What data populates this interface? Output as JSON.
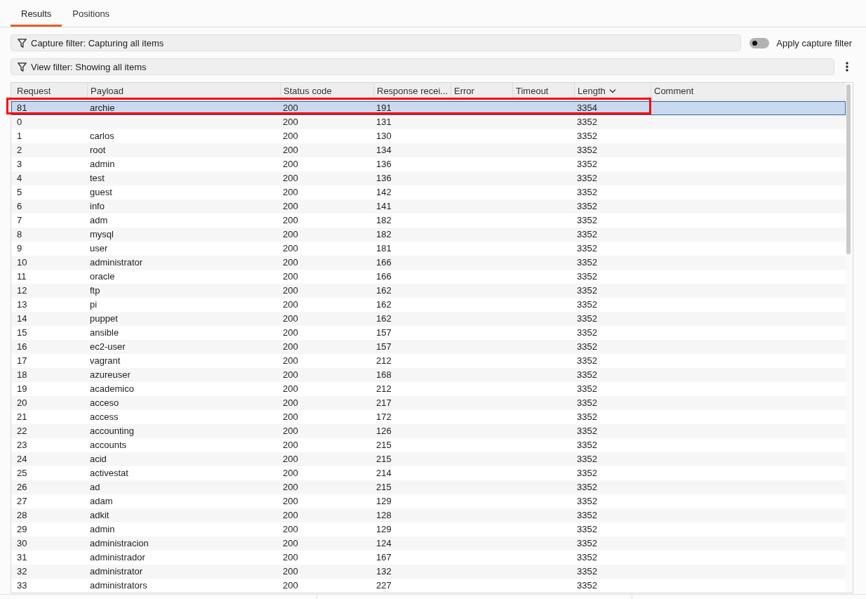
{
  "tabs": [
    {
      "label": "Results",
      "selected": true
    },
    {
      "label": "Positions",
      "selected": false
    }
  ],
  "capture_filter": {
    "label": "Capture filter: Capturing all items"
  },
  "apply_capture_filter": {
    "label": "Apply capture filter",
    "on": false
  },
  "view_filter": {
    "label": "View filter: Showing all items"
  },
  "table": {
    "columns": [
      {
        "label": "Request",
        "sorted": false
      },
      {
        "label": "Payload",
        "sorted": false
      },
      {
        "label": "Status code",
        "sorted": false
      },
      {
        "label": "Response recei...",
        "sorted": false
      },
      {
        "label": "Error",
        "sorted": false
      },
      {
        "label": "Timeout",
        "sorted": false
      },
      {
        "label": "Length",
        "sorted": true
      },
      {
        "label": "Comment",
        "sorted": false
      }
    ],
    "rows": [
      {
        "request": "81",
        "payload": "archie",
        "status_code": "200",
        "response_received": "191",
        "length": "3354",
        "selected": true,
        "highlighted": true
      },
      {
        "request": "0",
        "status_code": "200",
        "response_received": "131",
        "length": "3352",
        "selected": false,
        "highlighted": false
      },
      {
        "request": "1",
        "payload": "carlos",
        "status_code": "200",
        "response_received": "130",
        "length": "3352",
        "selected": false,
        "highlighted": false
      },
      {
        "request": "2",
        "payload": "root",
        "status_code": "200",
        "response_received": "134",
        "length": "3352",
        "selected": false,
        "highlighted": false
      },
      {
        "request": "3",
        "payload": "admin",
        "status_code": "200",
        "response_received": "136",
        "length": "3352",
        "selected": false,
        "highlighted": false
      },
      {
        "request": "4",
        "payload": "test",
        "status_code": "200",
        "response_received": "136",
        "length": "3352",
        "selected": false,
        "highlighted": false
      },
      {
        "request": "5",
        "payload": "guest",
        "status_code": "200",
        "response_received": "142",
        "length": "3352",
        "selected": false,
        "highlighted": false
      },
      {
        "request": "6",
        "payload": "info",
        "status_code": "200",
        "response_received": "141",
        "length": "3352",
        "selected": false,
        "highlighted": false
      },
      {
        "request": "7",
        "payload": "adm",
        "status_code": "200",
        "response_received": "182",
        "length": "3352",
        "selected": false,
        "highlighted": false
      },
      {
        "request": "8",
        "payload": "mysql",
        "status_code": "200",
        "response_received": "182",
        "length": "3352",
        "selected": false,
        "highlighted": false
      },
      {
        "request": "9",
        "payload": "user",
        "status_code": "200",
        "response_received": "181",
        "length": "3352",
        "selected": false,
        "highlighted": false
      },
      {
        "request": "10",
        "payload": "administrator",
        "status_code": "200",
        "response_received": "166",
        "length": "3352",
        "selected": false,
        "highlighted": false
      },
      {
        "request": "11",
        "payload": "oracle",
        "status_code": "200",
        "response_received": "166",
        "length": "3352",
        "selected": false,
        "highlighted": false
      },
      {
        "request": "12",
        "payload": "ftp",
        "status_code": "200",
        "response_received": "162",
        "length": "3352",
        "selected": false,
        "highlighted": false
      },
      {
        "request": "13",
        "payload": "pi",
        "status_code": "200",
        "response_received": "162",
        "length": "3352",
        "selected": false,
        "highlighted": false
      },
      {
        "request": "14",
        "payload": "puppet",
        "status_code": "200",
        "response_received": "162",
        "length": "3352",
        "selected": false,
        "highlighted": false
      },
      {
        "request": "15",
        "payload": "ansible",
        "status_code": "200",
        "response_received": "157",
        "length": "3352",
        "selected": false,
        "highlighted": false
      },
      {
        "request": "16",
        "payload": "ec2-user",
        "status_code": "200",
        "response_received": "157",
        "length": "3352",
        "selected": false,
        "highlighted": false
      },
      {
        "request": "17",
        "payload": "vagrant",
        "status_code": "200",
        "response_received": "212",
        "length": "3352",
        "selected": false,
        "highlighted": false
      },
      {
        "request": "18",
        "payload": "azureuser",
        "status_code": "200",
        "response_received": "168",
        "length": "3352",
        "selected": false,
        "highlighted": false
      },
      {
        "request": "19",
        "payload": "academico",
        "status_code": "200",
        "response_received": "212",
        "length": "3352",
        "selected": false,
        "highlighted": false
      },
      {
        "request": "20",
        "payload": "acceso",
        "status_code": "200",
        "response_received": "217",
        "length": "3352",
        "selected": false,
        "highlighted": false
      },
      {
        "request": "21",
        "payload": "access",
        "status_code": "200",
        "response_received": "172",
        "length": "3352",
        "selected": false,
        "highlighted": false
      },
      {
        "request": "22",
        "payload": "accounting",
        "status_code": "200",
        "response_received": "126",
        "length": "3352",
        "selected": false,
        "highlighted": false
      },
      {
        "request": "23",
        "payload": "accounts",
        "status_code": "200",
        "response_received": "215",
        "length": "3352",
        "selected": false,
        "highlighted": false
      },
      {
        "request": "24",
        "payload": "acid",
        "status_code": "200",
        "response_received": "215",
        "length": "3352",
        "selected": false,
        "highlighted": false
      },
      {
        "request": "25",
        "payload": "activestat",
        "status_code": "200",
        "response_received": "214",
        "length": "3352",
        "selected": false,
        "highlighted": false
      },
      {
        "request": "26",
        "payload": "ad",
        "status_code": "200",
        "response_received": "215",
        "length": "3352",
        "selected": false,
        "highlighted": false
      },
      {
        "request": "27",
        "payload": "adam",
        "status_code": "200",
        "response_received": "129",
        "length": "3352",
        "selected": false,
        "highlighted": false
      },
      {
        "request": "28",
        "payload": "adkit",
        "status_code": "200",
        "response_received": "128",
        "length": "3352",
        "selected": false,
        "highlighted": false
      },
      {
        "request": "29",
        "payload": "admin",
        "status_code": "200",
        "response_received": "129",
        "length": "3352",
        "selected": false,
        "highlighted": false
      },
      {
        "request": "30",
        "payload": "administracion",
        "status_code": "200",
        "response_received": "124",
        "length": "3352",
        "selected": false,
        "highlighted": false
      },
      {
        "request": "31",
        "payload": "administrador",
        "status_code": "200",
        "response_received": "167",
        "length": "3352",
        "selected": false,
        "highlighted": false
      },
      {
        "request": "32",
        "payload": "administrator",
        "status_code": "200",
        "response_received": "132",
        "length": "3352",
        "selected": false,
        "highlighted": false
      },
      {
        "request": "33",
        "payload": "administrators",
        "status_code": "200",
        "response_received": "227",
        "length": "3352",
        "selected": false,
        "highlighted": false
      }
    ]
  }
}
